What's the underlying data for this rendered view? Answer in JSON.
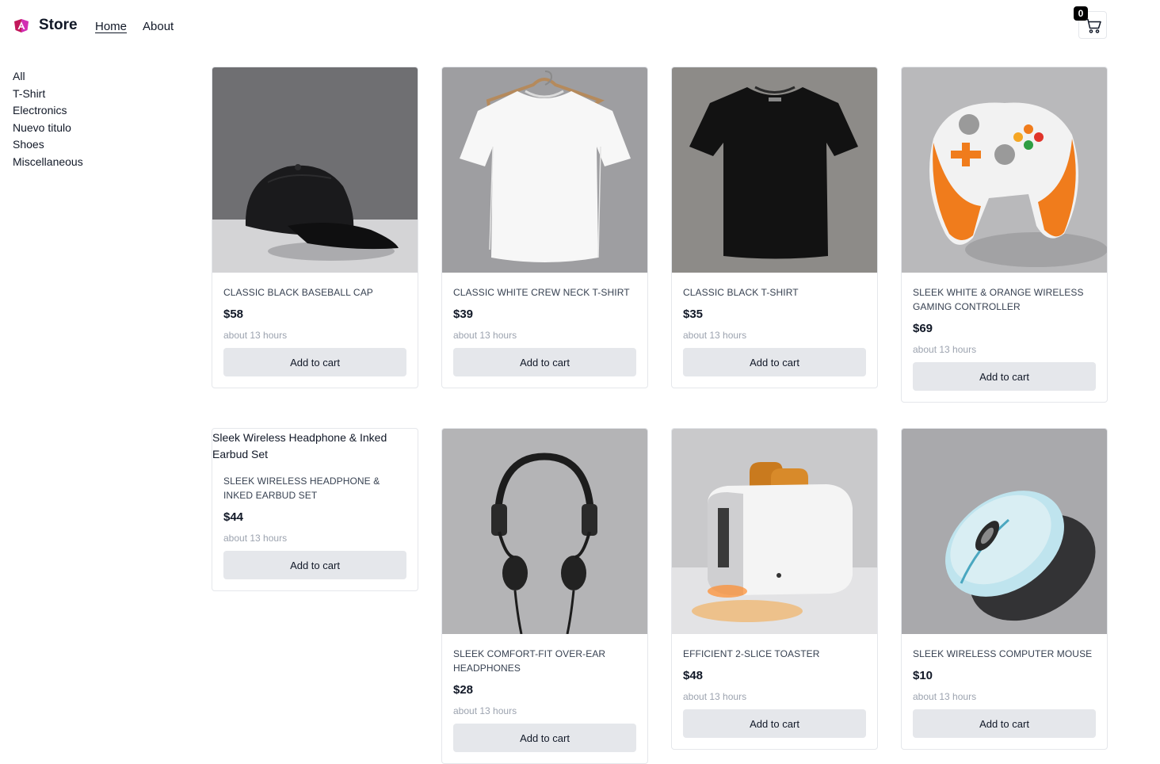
{
  "header": {
    "brand": "Store",
    "nav": {
      "home": "Home",
      "about": "About"
    },
    "cart_count": "0",
    "accent_color": "#c2185b"
  },
  "sidebar": {
    "categories": [
      "All",
      "T-Shirt",
      "Electronics",
      "Nuevo titulo",
      "Shoes",
      "Miscellaneous"
    ]
  },
  "products": [
    {
      "title": "Classic Black Baseball Cap",
      "price": "$58",
      "time": "about 13 hours",
      "button": "Add to cart",
      "image": "black-cap"
    },
    {
      "title": "Classic White Crew Neck T-Shirt",
      "price": "$39",
      "time": "about 13 hours",
      "button": "Add to cart",
      "image": "white-tshirt"
    },
    {
      "title": "Classic Black T-Shirt",
      "price": "$35",
      "time": "about 13 hours",
      "button": "Add to cart",
      "image": "black-tshirt"
    },
    {
      "title": "Sleek White & Orange Wireless Gaming Controller",
      "price": "$69",
      "time": "about 13 hours",
      "button": "Add to cart",
      "image": "game-controller"
    },
    {
      "title": "Sleek Wireless Headphone & Inked Earbud Set",
      "price": "$44",
      "time": "about 13 hours",
      "button": "Add to cart",
      "image_alt": "Sleek Wireless Headphone & Inked Earbud Set"
    },
    {
      "title": "Sleek Comfort-Fit Over-Ear Headphones",
      "price": "$28",
      "time": "about 13 hours",
      "button": "Add to cart",
      "image": "headphones"
    },
    {
      "title": "Efficient 2-Slice Toaster",
      "price": "$48",
      "time": "about 13 hours",
      "button": "Add to cart",
      "image": "toaster"
    },
    {
      "title": "Sleek Wireless Computer Mouse",
      "price": "$10",
      "time": "about 13 hours",
      "button": "Add to cart",
      "image": "computer-mouse"
    }
  ]
}
